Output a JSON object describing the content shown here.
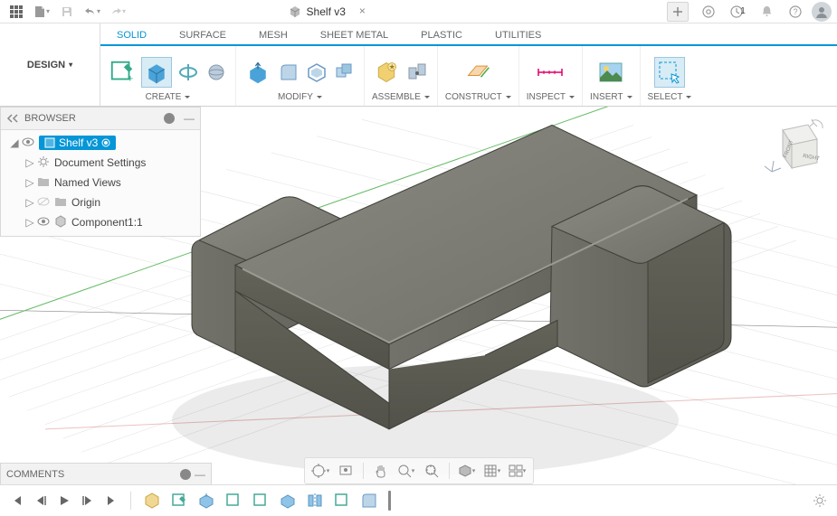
{
  "titleTab": "Shelf v3",
  "updatesCount": "1",
  "workspace": "DESIGN",
  "ribbonTabs": [
    "SOLID",
    "SURFACE",
    "MESH",
    "SHEET METAL",
    "PLASTIC",
    "UTILITIES"
  ],
  "ribbonActiveTab": "SOLID",
  "panels": {
    "create": "CREATE",
    "modify": "MODIFY",
    "assemble": "ASSEMBLE",
    "construct": "CONSTRUCT",
    "inspect": "INSPECT",
    "insert": "INSERT",
    "select": "SELECT"
  },
  "browser": {
    "title": "BROWSER",
    "root": "Shelf v3",
    "items": [
      {
        "label": "Document Settings",
        "icon": "gear"
      },
      {
        "label": "Named Views",
        "icon": "folder"
      },
      {
        "label": "Origin",
        "icon": "folder",
        "hidden": true
      },
      {
        "label": "Component1:1",
        "icon": "component"
      }
    ]
  },
  "comments": "COMMENTS"
}
